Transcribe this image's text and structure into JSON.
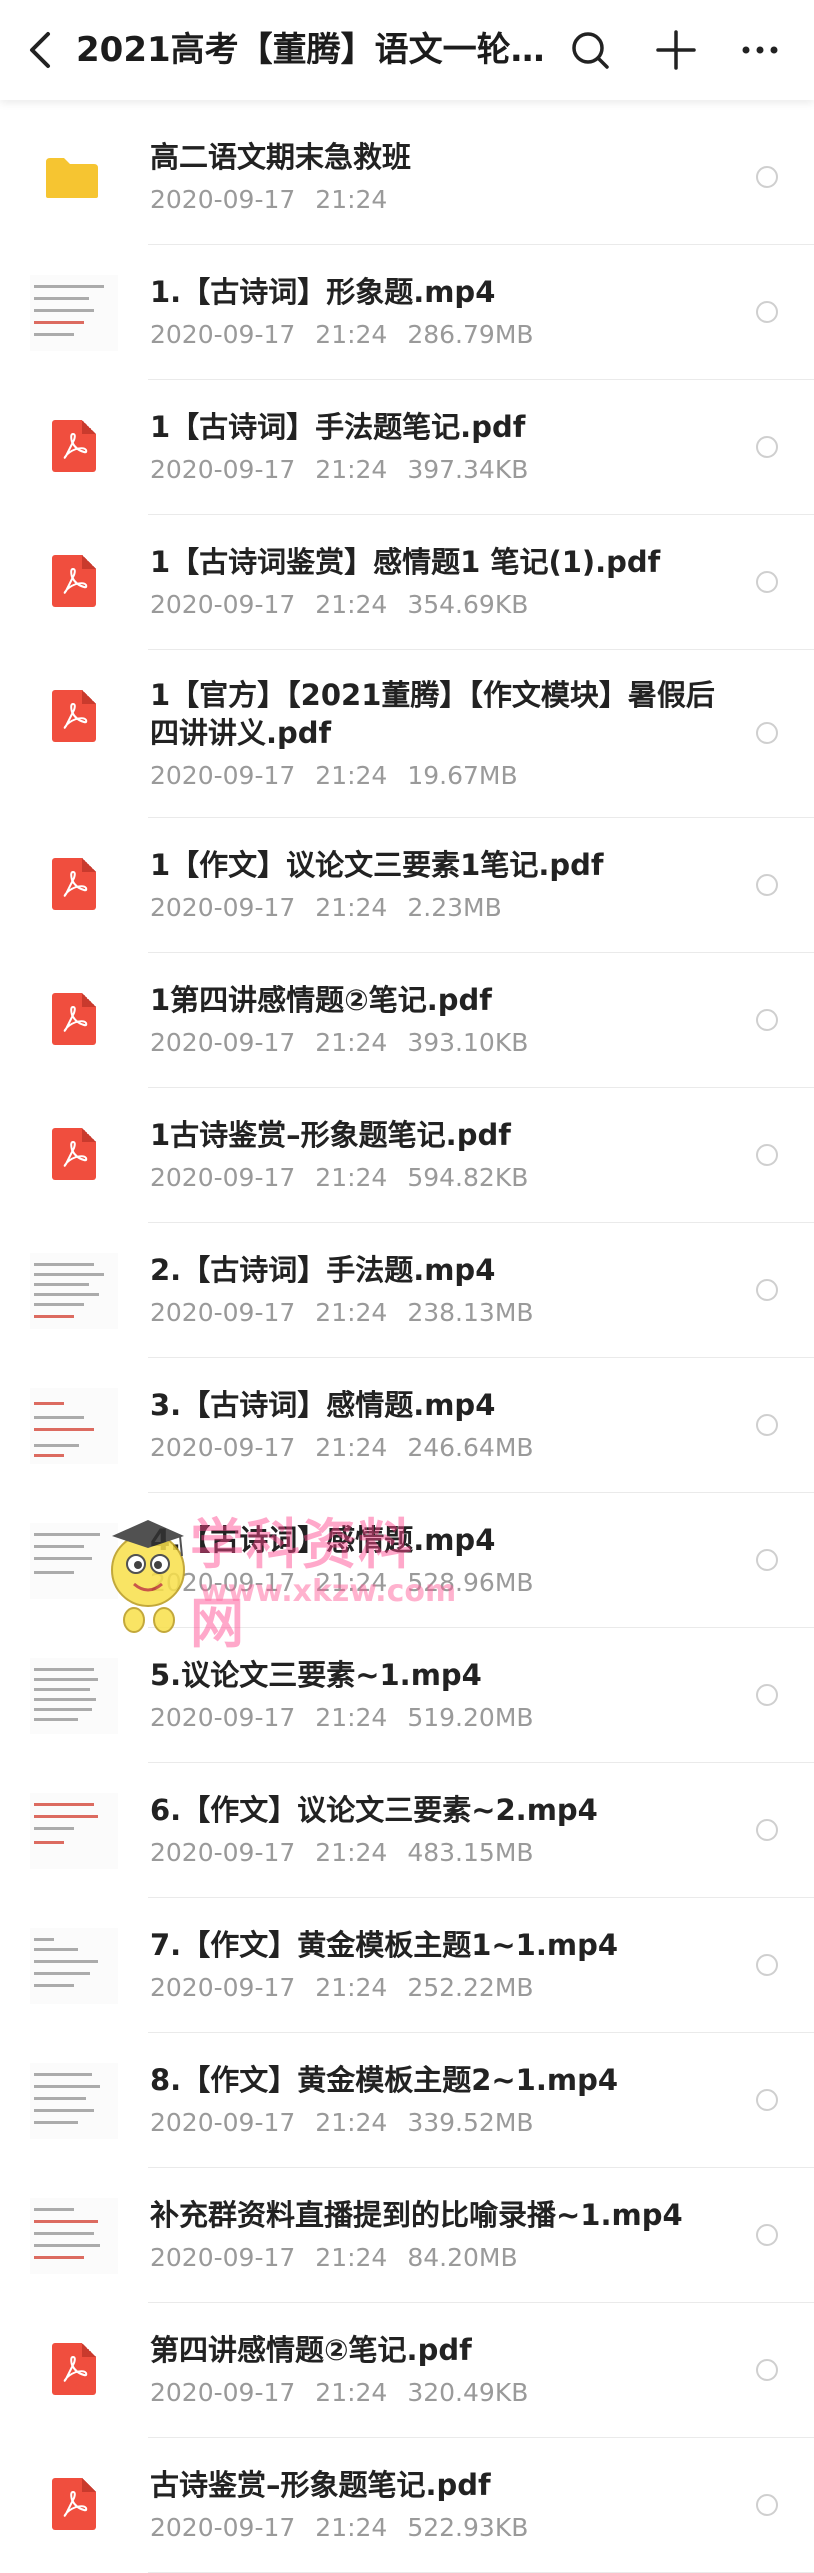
{
  "header": {
    "title": "2021高考【董腾】语文一轮..."
  },
  "icons": {
    "back": "chevron-left",
    "search": "search",
    "add": "plus",
    "more": "more-horizontal"
  },
  "colors": {
    "pdf": "#f04e3e",
    "folder": "#f6c531",
    "meta_text": "#9a9a9a"
  },
  "files": [
    {
      "type": "folder",
      "name": "高二语文期末急救班",
      "date": "2020-09-17",
      "time": "21:24",
      "size": ""
    },
    {
      "type": "video",
      "name": "1.【古诗词】形象题.mp4",
      "date": "2020-09-17",
      "time": "21:24",
      "size": "286.79MB"
    },
    {
      "type": "pdf",
      "name": "1【古诗词】手法题笔记.pdf",
      "date": "2020-09-17",
      "time": "21:24",
      "size": "397.34KB"
    },
    {
      "type": "pdf",
      "name": "1【古诗词鉴赏】感情题1 笔记(1).pdf",
      "date": "2020-09-17",
      "time": "21:24",
      "size": "354.69KB"
    },
    {
      "type": "pdf",
      "name": "1【官方】【2021董腾】【作文模块】暑假后四讲讲义.pdf",
      "date": "2020-09-17",
      "time": "21:24",
      "size": "19.67MB"
    },
    {
      "type": "pdf",
      "name": "1【作文】议论文三要素1笔记.pdf",
      "date": "2020-09-17",
      "time": "21:24",
      "size": "2.23MB"
    },
    {
      "type": "pdf",
      "name": "1第四讲感情题②笔记.pdf",
      "date": "2020-09-17",
      "time": "21:24",
      "size": "393.10KB"
    },
    {
      "type": "pdf",
      "name": "1古诗鉴赏–形象题笔记.pdf",
      "date": "2020-09-17",
      "time": "21:24",
      "size": "594.82KB"
    },
    {
      "type": "video",
      "name": "2.【古诗词】手法题.mp4",
      "date": "2020-09-17",
      "time": "21:24",
      "size": "238.13MB"
    },
    {
      "type": "video",
      "name": "3.【古诗词】感情题.mp4",
      "date": "2020-09-17",
      "time": "21:24",
      "size": "246.64MB"
    },
    {
      "type": "video",
      "name": "4.【古诗词】感情题.mp4",
      "date": "2020-09-17",
      "time": "21:24",
      "size": "528.96MB"
    },
    {
      "type": "video",
      "name": "5.议论文三要素~1.mp4",
      "date": "2020-09-17",
      "time": "21:24",
      "size": "519.20MB"
    },
    {
      "type": "video",
      "name": "6.【作文】议论文三要素~2.mp4",
      "date": "2020-09-17",
      "time": "21:24",
      "size": "483.15MB"
    },
    {
      "type": "video",
      "name": "7.【作文】黄金模板主题1~1.mp4",
      "date": "2020-09-17",
      "time": "21:24",
      "size": "252.22MB"
    },
    {
      "type": "video",
      "name": "8.【作文】黄金模板主题2~1.mp4",
      "date": "2020-09-17",
      "time": "21:24",
      "size": "339.52MB"
    },
    {
      "type": "video",
      "name": "补充群资料直播提到的比喻录播~1.mp4",
      "date": "2020-09-17",
      "time": "21:24",
      "size": "84.20MB"
    },
    {
      "type": "pdf",
      "name": "第四讲感情题②笔记.pdf",
      "date": "2020-09-17",
      "time": "21:24",
      "size": "320.49KB"
    },
    {
      "type": "pdf",
      "name": "古诗鉴赏–形象题笔记.pdf",
      "date": "2020-09-17",
      "time": "21:24",
      "size": "522.93KB"
    }
  ],
  "watermark": {
    "text": "学科资料网",
    "url": "www.xkzw.com"
  }
}
